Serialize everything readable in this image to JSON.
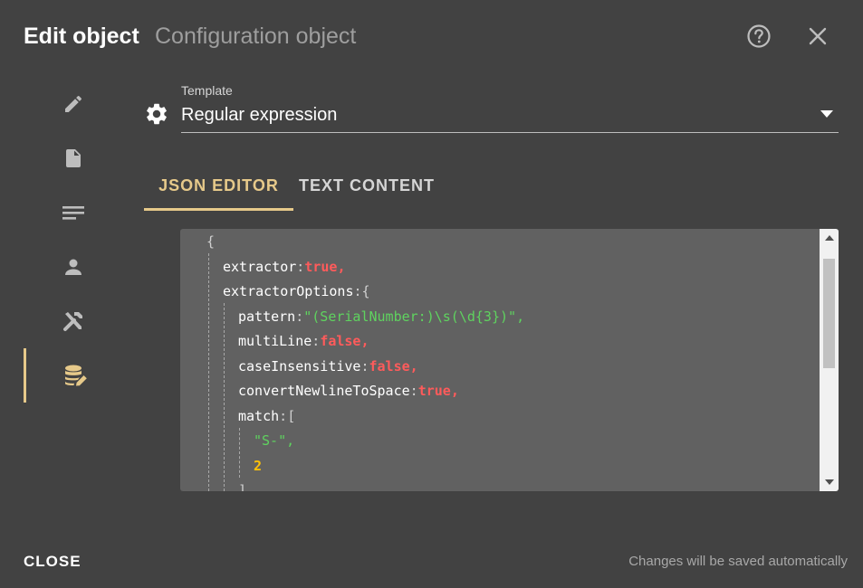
{
  "header": {
    "title": "Edit object",
    "subtitle": "Configuration object",
    "help_icon": "help-circle-icon",
    "close_icon": "close-icon"
  },
  "sidenav": {
    "items": [
      {
        "icon": "pencil-icon",
        "active": false
      },
      {
        "icon": "document-icon",
        "active": false
      },
      {
        "icon": "lines-icon",
        "active": false
      },
      {
        "icon": "person-icon",
        "active": false
      },
      {
        "icon": "tools-icon",
        "active": false
      },
      {
        "icon": "database-edit-icon",
        "active": true
      }
    ]
  },
  "template": {
    "label": "Template",
    "value": "Regular expression",
    "icon": "gear-icon"
  },
  "tabs": [
    {
      "label": "JSON EDITOR",
      "active": true
    },
    {
      "label": "TEXT CONTENT",
      "active": false
    }
  ],
  "editor": {
    "lines": [
      {
        "key": "",
        "value": "{"
      },
      {
        "key": "extractor",
        "value": "true"
      },
      {
        "key": "extractorOptions",
        "value": "{"
      },
      {
        "key": "pattern",
        "value": "\"(SerialNumber:)\\s(\\d{3})\""
      },
      {
        "key": "multiLine",
        "value": "false"
      },
      {
        "key": "caseInsensitive",
        "value": "false"
      },
      {
        "key": "convertNewlineToSpace",
        "value": "true"
      },
      {
        "key": "match",
        "value": "["
      },
      {
        "key": "",
        "value": "\"S-\""
      },
      {
        "key": "",
        "value": "2"
      },
      {
        "key": "",
        "value": "]"
      }
    ]
  },
  "footer": {
    "close_label": "CLOSE",
    "status": "Changes will be saved automatically"
  },
  "colors": {
    "background": "#424242",
    "accent": "#e6c98a",
    "editor_bg": "#616161",
    "keyword": "#ff5b5b",
    "string": "#5fd35f",
    "number": "#ffc107"
  }
}
